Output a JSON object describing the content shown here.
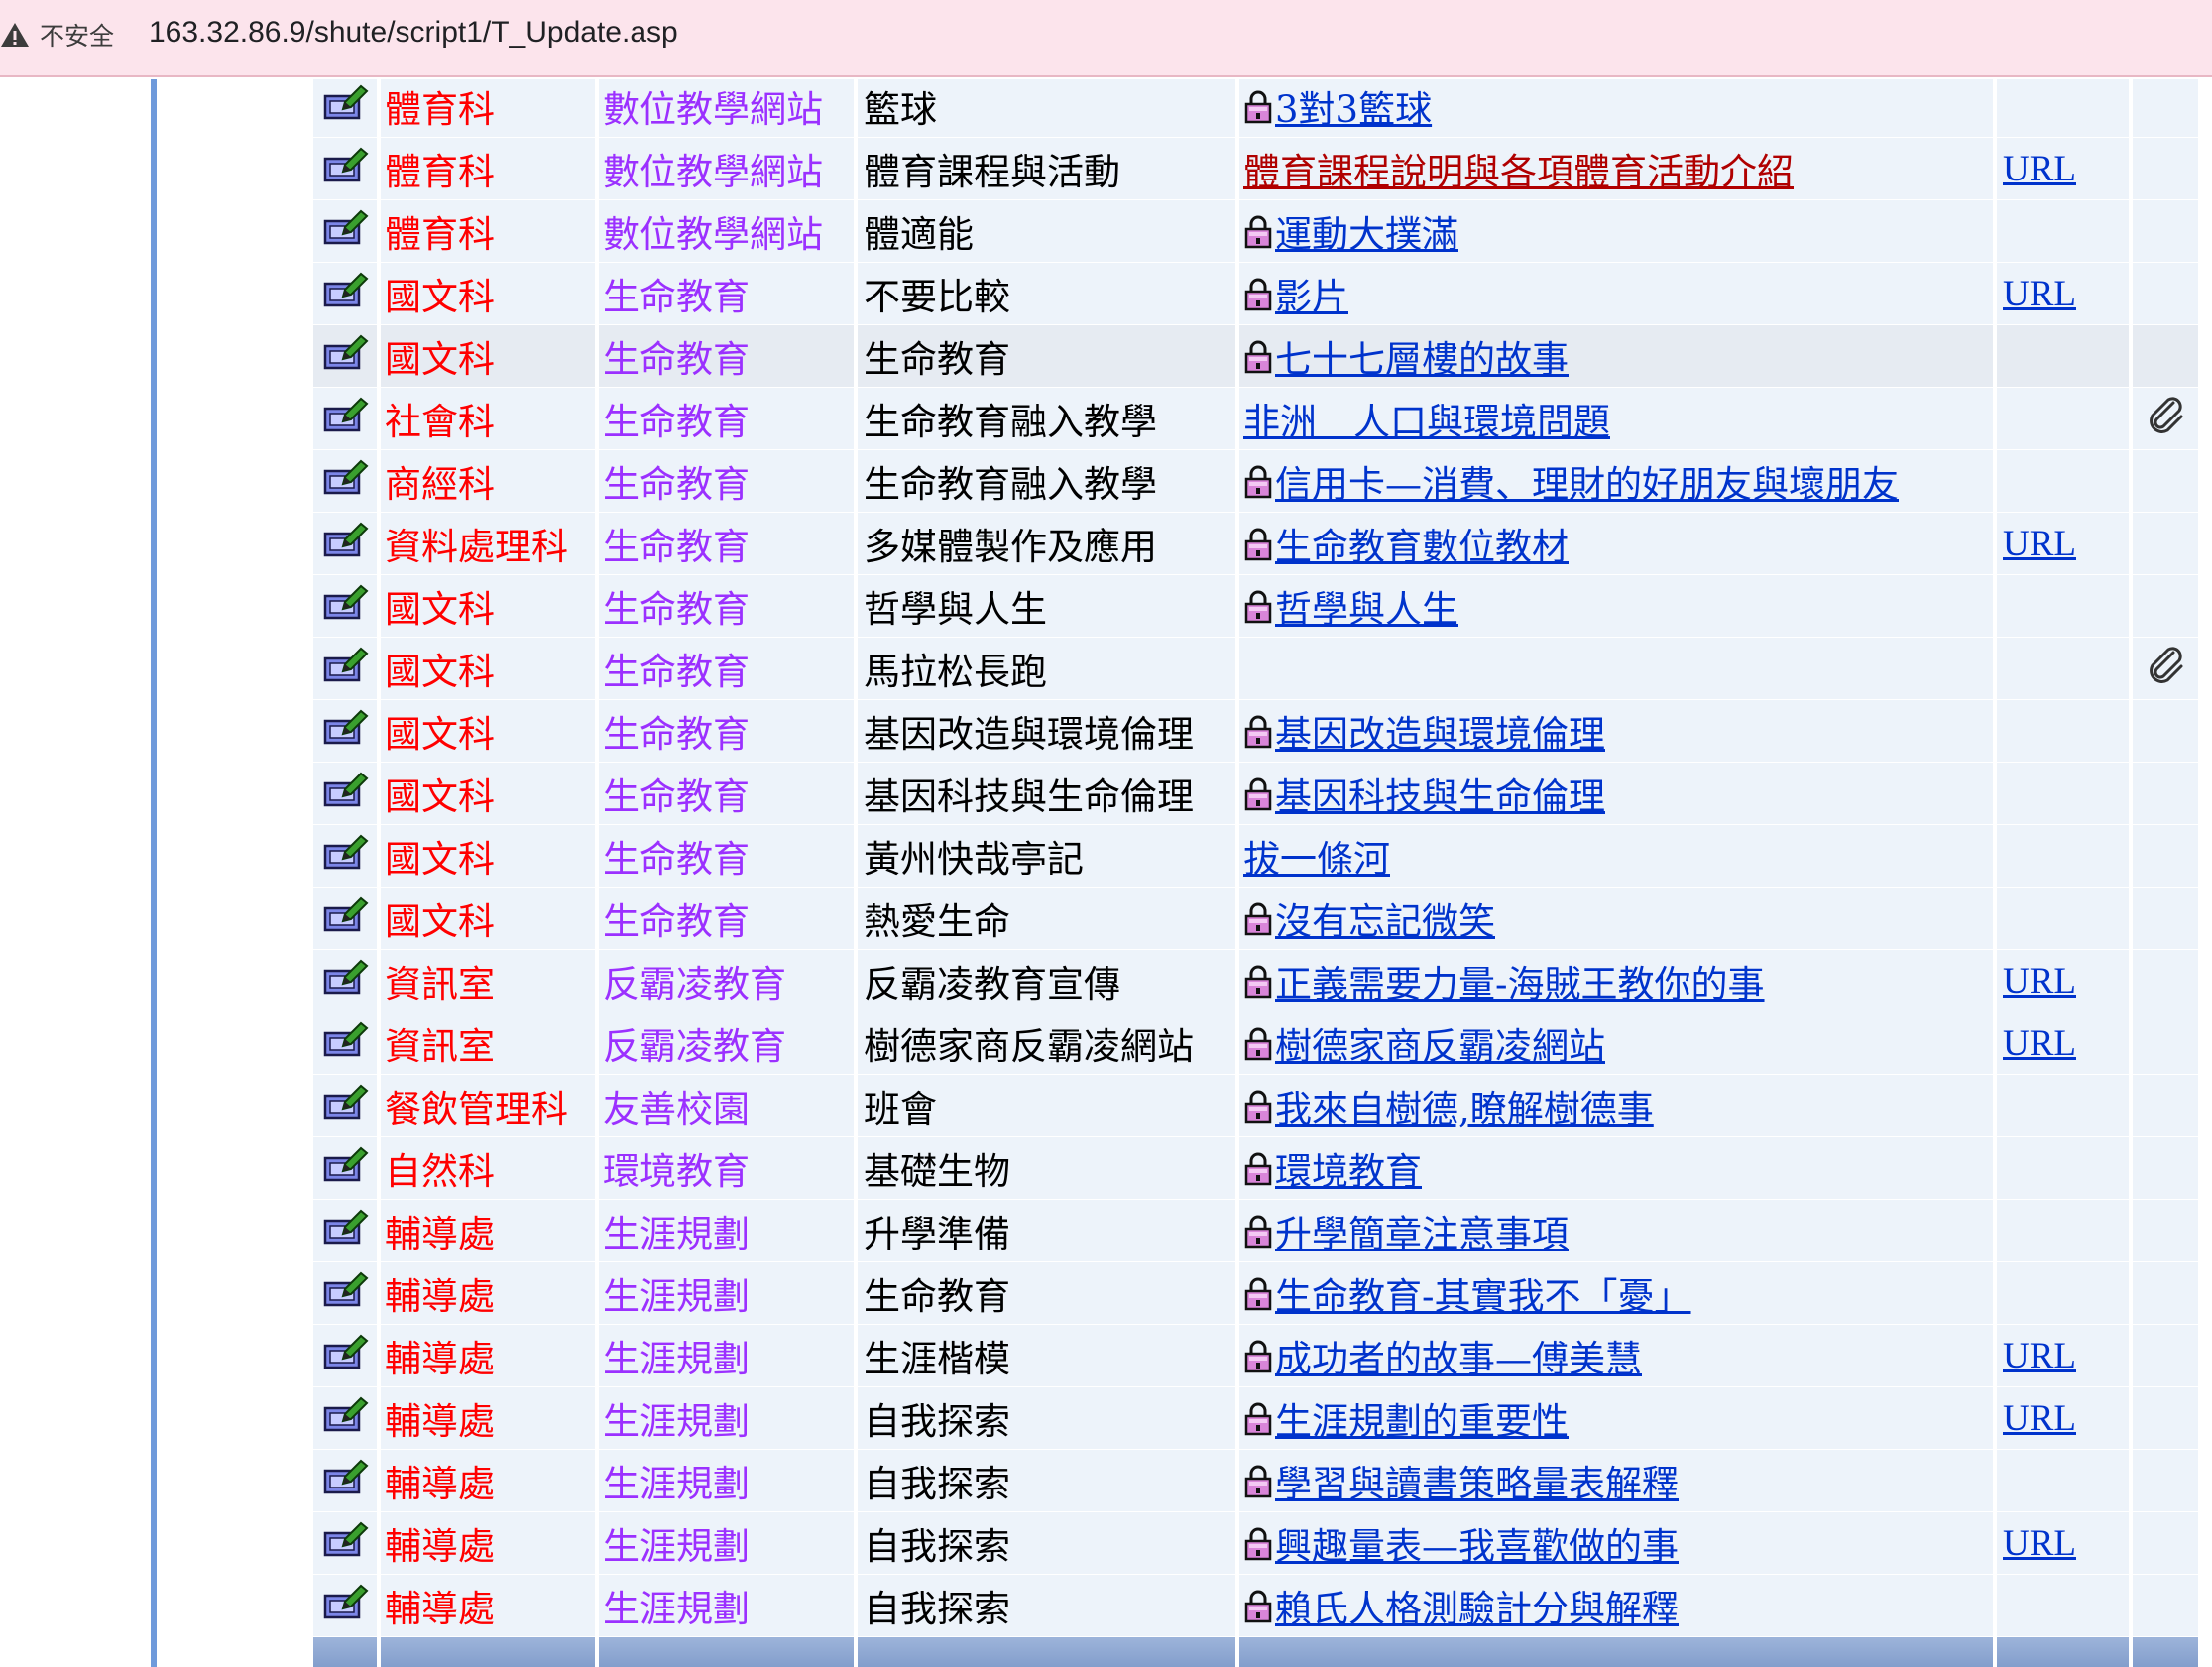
{
  "browser": {
    "security_label": "不安全",
    "url": "163.32.86.9/shute/script1/T_Update.asp"
  },
  "table": {
    "rows": [
      {
        "dept": "體育科",
        "category": "數位教學網站",
        "course": "籃球",
        "resource": "3對3籃球",
        "lock": true,
        "url": "",
        "attachment": false
      },
      {
        "dept": "體育科",
        "category": "數位教學網站",
        "course": "體育課程與活動",
        "resource": "體育課程說明與各項體育活動介紹",
        "lock": false,
        "visited": true,
        "url": "URL",
        "attachment": false
      },
      {
        "dept": "體育科",
        "category": "數位教學網站",
        "course": "體適能",
        "resource": "運動大撲滿",
        "lock": true,
        "url": "",
        "attachment": false
      },
      {
        "dept": "國文科",
        "category": "生命教育",
        "course": "不要比較",
        "resource": "影片",
        "lock": true,
        "url": "URL",
        "attachment": false
      },
      {
        "dept": "國文科",
        "category": "生命教育",
        "course": "生命教育",
        "resource": "七十七層樓的故事",
        "lock": true,
        "url": "",
        "attachment": false,
        "highlight": true
      },
      {
        "dept": "社會科",
        "category": "生命教育",
        "course": "生命教育融入教學",
        "resource": "非洲　人口與環境問題",
        "lock": false,
        "url": "",
        "attachment": true
      },
      {
        "dept": "商經科",
        "category": "生命教育",
        "course": "生命教育融入教學",
        "resource": "信用卡—消費、理財的好朋友與壞朋友",
        "lock": true,
        "url": "",
        "attachment": false
      },
      {
        "dept": "資料處理科",
        "category": "生命教育",
        "course": "多媒體製作及應用",
        "resource": "生命教育數位教材",
        "lock": true,
        "url": "URL",
        "attachment": false
      },
      {
        "dept": "國文科",
        "category": "生命教育",
        "course": "哲學與人生",
        "resource": "哲學與人生",
        "lock": true,
        "url": "",
        "attachment": false
      },
      {
        "dept": "國文科",
        "category": "生命教育",
        "course": "馬拉松長跑",
        "resource": "",
        "lock": false,
        "url": "",
        "attachment": true
      },
      {
        "dept": "國文科",
        "category": "生命教育",
        "course": "基因改造與環境倫理",
        "resource": "基因改造與環境倫理",
        "lock": true,
        "url": "",
        "attachment": false
      },
      {
        "dept": "國文科",
        "category": "生命教育",
        "course": "基因科技與生命倫理",
        "resource": "基因科技與生命倫理",
        "lock": true,
        "url": "",
        "attachment": false
      },
      {
        "dept": "國文科",
        "category": "生命教育",
        "course": "黃州快哉亭記",
        "resource": "拔一條河",
        "lock": false,
        "url": "",
        "attachment": false
      },
      {
        "dept": "國文科",
        "category": "生命教育",
        "course": "熱愛生命",
        "resource": "沒有忘記微笑",
        "lock": true,
        "url": "",
        "attachment": false
      },
      {
        "dept": "資訊室",
        "category": "反霸凌教育",
        "course": "反霸凌教育宣傳",
        "resource": "正義需要力量-海賊王教你的事",
        "lock": true,
        "url": "URL",
        "attachment": false
      },
      {
        "dept": "資訊室",
        "category": "反霸凌教育",
        "course": "樹德家商反霸凌網站",
        "resource": "樹德家商反霸凌網站",
        "lock": true,
        "url": "URL",
        "attachment": false
      },
      {
        "dept": "餐飲管理科",
        "category": "友善校園",
        "course": "班會",
        "resource": "我來自樹德,瞭解樹德事",
        "lock": true,
        "url": "",
        "attachment": false
      },
      {
        "dept": "自然科",
        "category": "環境教育",
        "course": "基礎生物",
        "resource": "環境教育",
        "lock": true,
        "url": "",
        "attachment": false
      },
      {
        "dept": "輔導處",
        "category": "生涯規劃",
        "course": "升學準備",
        "resource": "升學簡章注意事項",
        "lock": true,
        "url": "",
        "attachment": false
      },
      {
        "dept": "輔導處",
        "category": "生涯規劃",
        "course": "生命教育",
        "resource": "生命教育-其實我不「憂」",
        "lock": true,
        "url": "",
        "attachment": false
      },
      {
        "dept": "輔導處",
        "category": "生涯規劃",
        "course": "生涯楷模",
        "resource": "成功者的故事—傅美慧",
        "lock": true,
        "url": "URL",
        "attachment": false
      },
      {
        "dept": "輔導處",
        "category": "生涯規劃",
        "course": "自我探索",
        "resource": "生涯規劃的重要性",
        "lock": true,
        "url": "URL",
        "attachment": false
      },
      {
        "dept": "輔導處",
        "category": "生涯規劃",
        "course": "自我探索",
        "resource": "學習與讀書策略量表解釋",
        "lock": true,
        "url": "",
        "attachment": false
      },
      {
        "dept": "輔導處",
        "category": "生涯規劃",
        "course": "自我探索",
        "resource": "興趣量表—我喜歡做的事",
        "lock": true,
        "url": "URL",
        "attachment": false
      },
      {
        "dept": "輔導處",
        "category": "生涯規劃",
        "course": "自我探索",
        "resource": "賴氏人格測驗計分與解釋",
        "lock": true,
        "url": "",
        "attachment": false
      }
    ]
  },
  "icons": {
    "row_edit": "edit-icon",
    "lock": "lock-icon",
    "attachment": "paperclip-icon",
    "warning": "warning-icon"
  },
  "colors": {
    "dept": "#ff0000",
    "category": "#9b30ff",
    "link": "#0033cc",
    "visited_link": "#b00000",
    "row_bg": "#edf3fa",
    "highlight_bg": "#e6ebf2",
    "footer": "#7696c6",
    "addressbar": "#fce4ec"
  }
}
